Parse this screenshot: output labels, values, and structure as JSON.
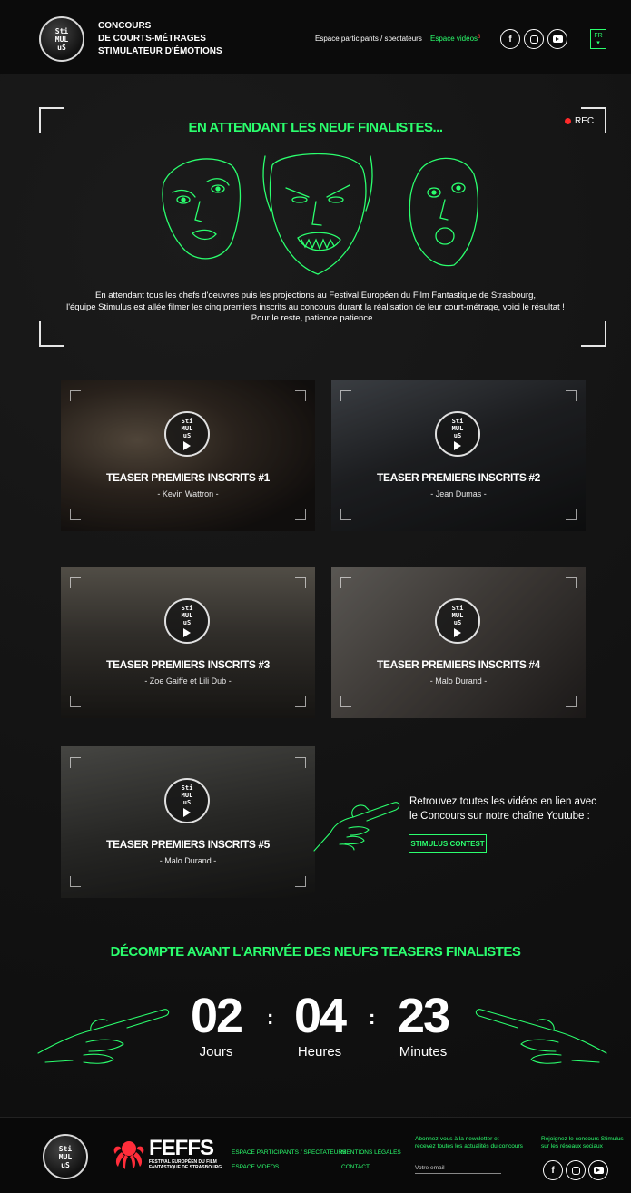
{
  "header": {
    "logo_lines": [
      "Sti",
      "MUL",
      "uS"
    ],
    "brand_lines": [
      "CONCOURS",
      "DE COURTS-MÉTRAGES",
      "STIMULATEUR D'ÉMOTIONS"
    ],
    "nav": {
      "participants": "Espace participants / spectateurs",
      "videos": "Espace vidéos",
      "videos_badge": "3"
    },
    "social": [
      "facebook-icon",
      "instagram-icon",
      "youtube-icon"
    ],
    "lang": {
      "code": "FR",
      "caret": "▾"
    }
  },
  "hero": {
    "title": "EN ATTENDANT LES NEUF FINALISTES...",
    "rec_label": "REC",
    "text_lines": [
      "En attendant tous les chefs d'oeuvres puis les projections au Festival Européen du Film Fantastique de Strasbourg,",
      "l'équipe Stimulus est allée filmer les cinq premiers inscrits au concours durant la réalisation de leur court-métrage, voici le résultat !",
      "Pour le reste, patience patience..."
    ]
  },
  "videos": [
    {
      "title": "TEASER PREMIERS INSCRITS #1",
      "author": "- Kevin Wattron -"
    },
    {
      "title": "TEASER PREMIERS INSCRITS #2",
      "author": "- Jean Dumas -"
    },
    {
      "title": "TEASER PREMIERS INSCRITS #3",
      "author": "- Zoe Gaiffe et Lili Dub -"
    },
    {
      "title": "TEASER PREMIERS INSCRITS #4",
      "author": "- Malo Durand -"
    },
    {
      "title": "TEASER PREMIERS INSCRITS #5",
      "author": "- Malo Durand -"
    }
  ],
  "youtube": {
    "text": "Retrouvez toutes les vidéos en lien avec le Concours sur notre chaîne Youtube :",
    "button": "STIMULUS CONTEST"
  },
  "countdown": {
    "title": "DÉCOMPTE AVANT L'ARRIVÉE DES NEUFS TEASERS FINALISTES",
    "separator": ":",
    "days": {
      "value": "02",
      "label": "Jours"
    },
    "hours": {
      "value": "04",
      "label": "Heures"
    },
    "minutes": {
      "value": "23",
      "label": "Minutes"
    }
  },
  "footer": {
    "feffs_name": "FEFFS",
    "feffs_sub_1": "FESTIVAL EUROPÉEN DU FILM",
    "feffs_sub_2": "FANTASTIQUE DE STRASBOURG",
    "links_col1": [
      "ESPACE PARTICIPANTS / SPECTATEURS",
      "ESPACE VIDEOS"
    ],
    "links_col2": [
      "MENTIONS LÉGALES",
      "CONTACT"
    ],
    "newsletter_1": "Abonnez-vous à la newsletter et",
    "newsletter_2": "recevez toutes les actualités du concours",
    "email_placeholder": "Votre email",
    "social_note_1": "Rejoignez le concours Stimulus",
    "social_note_2": "sur les réseaux sociaux"
  },
  "colors": {
    "accent": "#2bff6e",
    "rec": "#ff2a2a",
    "bg": "#111111"
  }
}
